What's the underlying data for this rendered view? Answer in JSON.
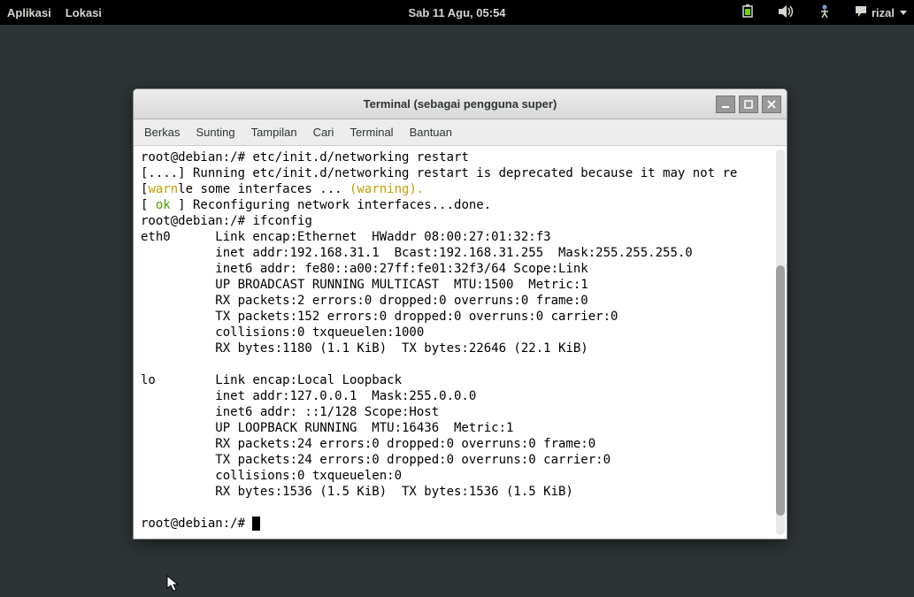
{
  "topbar": {
    "applications": "Aplikasi",
    "locations": "Lokasi",
    "datetime": "Sab 11 Agu, 05:54",
    "username": "rizal"
  },
  "window": {
    "title": "Terminal (sebagai pengguna super)"
  },
  "menubar": {
    "file": "Berkas",
    "edit": "Sunting",
    "view": "Tampilan",
    "search": "Cari",
    "terminal": "Terminal",
    "help": "Bantuan"
  },
  "terminal": {
    "line1_prompt": "root@debian:/# ",
    "line1_cmd": "etc/init.d/networking restart",
    "line2": "[....] Running etc/init.d/networking restart is deprecated because it may not re",
    "line3_a": "[",
    "line3_warn": "warn",
    "line3_b": "le some interfaces ... ",
    "line3_c": "(warning).",
    "line4_a": "[ ",
    "line4_ok": "ok",
    "line4_b": " ] Reconfiguring network interfaces...done.",
    "line5_prompt": "root@debian:/# ",
    "line5_cmd": "ifconfig",
    "eth0_l1": "eth0      Link encap:Ethernet  HWaddr 08:00:27:01:32:f3",
    "eth0_l2": "          inet addr:192.168.31.1  Bcast:192.168.31.255  Mask:255.255.255.0",
    "eth0_l3": "          inet6 addr: fe80::a00:27ff:fe01:32f3/64 Scope:Link",
    "eth0_l4": "          UP BROADCAST RUNNING MULTICAST  MTU:1500  Metric:1",
    "eth0_l5": "          RX packets:2 errors:0 dropped:0 overruns:0 frame:0",
    "eth0_l6": "          TX packets:152 errors:0 dropped:0 overruns:0 carrier:0",
    "eth0_l7": "          collisions:0 txqueuelen:1000",
    "eth0_l8": "          RX bytes:1180 (1.1 KiB)  TX bytes:22646 (22.1 KiB)",
    "lo_l1": "lo        Link encap:Local Loopback",
    "lo_l2": "          inet addr:127.0.0.1  Mask:255.0.0.0",
    "lo_l3": "          inet6 addr: ::1/128 Scope:Host",
    "lo_l4": "          UP LOOPBACK RUNNING  MTU:16436  Metric:1",
    "lo_l5": "          RX packets:24 errors:0 dropped:0 overruns:0 frame:0",
    "lo_l6": "          TX packets:24 errors:0 dropped:0 overruns:0 carrier:0",
    "lo_l7": "          collisions:0 txqueuelen:0",
    "lo_l8": "          RX bytes:1536 (1.5 KiB)  TX bytes:1536 (1.5 KiB)",
    "final_prompt": "root@debian:/# "
  }
}
